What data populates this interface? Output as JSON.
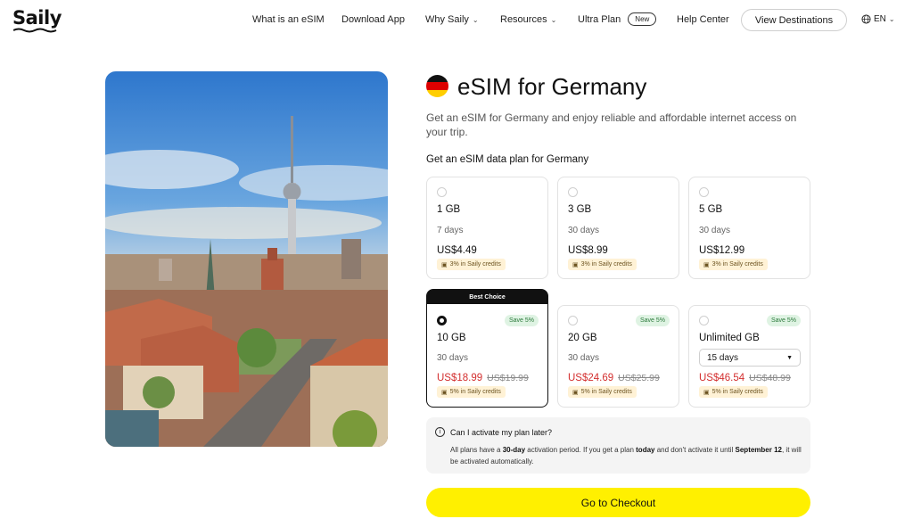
{
  "header": {
    "logo": "Saily",
    "nav": [
      {
        "label": "What is an eSIM"
      },
      {
        "label": "Download App"
      },
      {
        "label": "Why Saily"
      },
      {
        "label": "Resources"
      },
      {
        "label": "Ultra Plan"
      },
      {
        "label": "Help Center"
      }
    ],
    "ultra_badge": "New",
    "view_destinations": "View Destinations",
    "language": "EN"
  },
  "page": {
    "title": "eSIM for Germany",
    "subtitle": "Get an eSIM for Germany and enjoy reliable and affordable internet access on your trip.",
    "plans_label": "Get an eSIM data plan for Germany"
  },
  "plans": [
    {
      "gb": "1 GB",
      "days": "7 days",
      "price": "US$4.49",
      "credits": "3% in Saily credits"
    },
    {
      "gb": "3 GB",
      "days": "30 days",
      "price": "US$8.99",
      "credits": "3% in Saily credits"
    },
    {
      "gb": "5 GB",
      "days": "30 days",
      "price": "US$12.99",
      "credits": "3% in Saily credits"
    },
    {
      "gb": "10 GB",
      "days": "30 days",
      "price": "US$18.99",
      "old_price": "US$19.99",
      "credits": "5% in Saily credits",
      "save": "Save 5%",
      "best": "Best Choice"
    },
    {
      "gb": "20 GB",
      "days": "30 days",
      "price": "US$24.69",
      "old_price": "US$25.99",
      "credits": "5% in Saily credits",
      "save": "Save 5%"
    },
    {
      "gb": "Unlimited GB",
      "days": "15 days",
      "price": "US$46.54",
      "old_price": "US$48.99",
      "credits": "5% in Saily credits",
      "save": "Save 5%"
    }
  ],
  "info": {
    "question": "Can I activate my plan later?",
    "answer_1": "All plans have a ",
    "answer_bold_1": "30-day",
    "answer_2": " activation period. If you get a plan ",
    "answer_bold_2": "today",
    "answer_3": " and don't activate it until ",
    "answer_bold_3": "September 12",
    "answer_4": ", it will be activated automatically."
  },
  "checkout": "Go to Checkout",
  "colors": {
    "accent_yellow": "#fff000",
    "sale_red": "#d32f2f",
    "save_green": "#2c7a3c"
  }
}
